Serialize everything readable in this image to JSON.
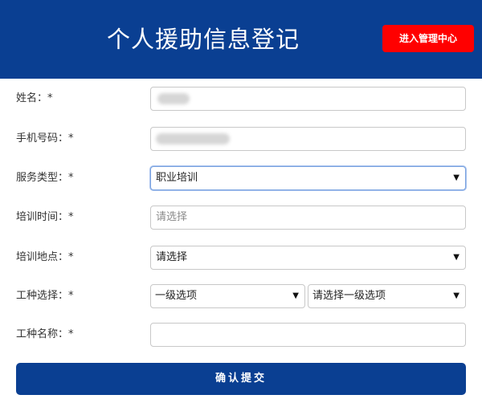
{
  "header": {
    "title": "个人援助信息登记",
    "admin_button_label": "进入管理中心"
  },
  "form": {
    "name": {
      "label": "姓名：*",
      "value": ""
    },
    "phone": {
      "label": "手机号码：*",
      "value": ""
    },
    "service_type": {
      "label": "服务类型：*",
      "value": "职业培训"
    },
    "training_time": {
      "label": "培训时间：*",
      "placeholder": "请选择"
    },
    "training_location": {
      "label": "培训地点：*",
      "value": "请选择"
    },
    "job_type": {
      "label": "工种选择：*",
      "level1_value": "一级选项",
      "level2_value": "请选择一级选项"
    },
    "job_name": {
      "label": "工种名称：*",
      "value": ""
    }
  },
  "submit": {
    "label": "确认提交"
  },
  "colors": {
    "brand": "#0a3f92",
    "admin_button": "#ff0000"
  }
}
